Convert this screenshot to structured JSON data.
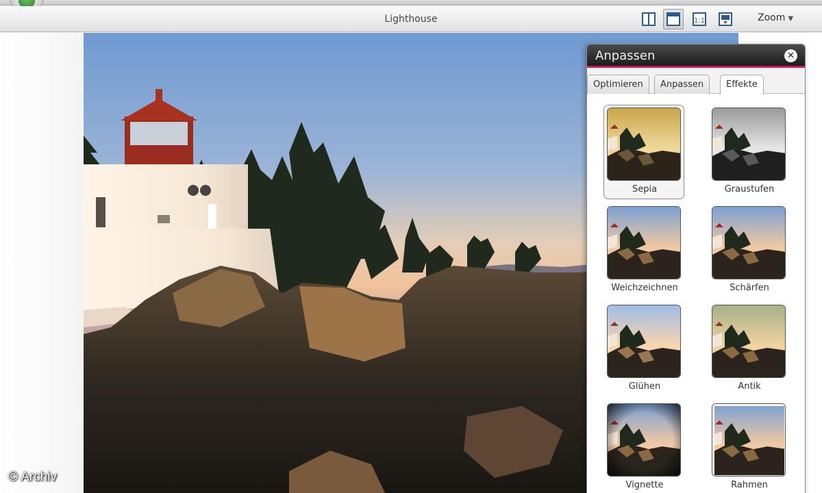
{
  "app": {
    "document_title": "Lighthouse",
    "zoom_label": "Zoom",
    "view_buttons": [
      {
        "icon": "split-view-icon",
        "active": false
      },
      {
        "icon": "filmstrip-view-icon",
        "active": true
      },
      {
        "icon": "actual-size-icon",
        "active": false
      },
      {
        "icon": "fit-to-window-icon",
        "active": false
      }
    ]
  },
  "panel": {
    "title": "Anpassen",
    "accent_color": "#d2155a",
    "tabs": [
      {
        "label": "Optimieren",
        "active": false
      },
      {
        "label": "Anpassen",
        "active": false
      },
      {
        "label": "Effekte",
        "active": true
      }
    ],
    "effects": [
      {
        "label": "Sepia",
        "selected": true,
        "style": "sepia"
      },
      {
        "label": "Graustufen",
        "selected": false,
        "style": "gray"
      },
      {
        "label": "Weichzeichnen",
        "selected": false,
        "style": "normal"
      },
      {
        "label": "Schärfen",
        "selected": false,
        "style": "normal"
      },
      {
        "label": "Glühen",
        "selected": false,
        "style": "glow"
      },
      {
        "label": "Antik",
        "selected": false,
        "style": "antique"
      },
      {
        "label": "Vignette",
        "selected": false,
        "style": "vignette"
      },
      {
        "label": "Rahmen",
        "selected": false,
        "style": "frame"
      }
    ]
  },
  "watermark": "© Archiv"
}
